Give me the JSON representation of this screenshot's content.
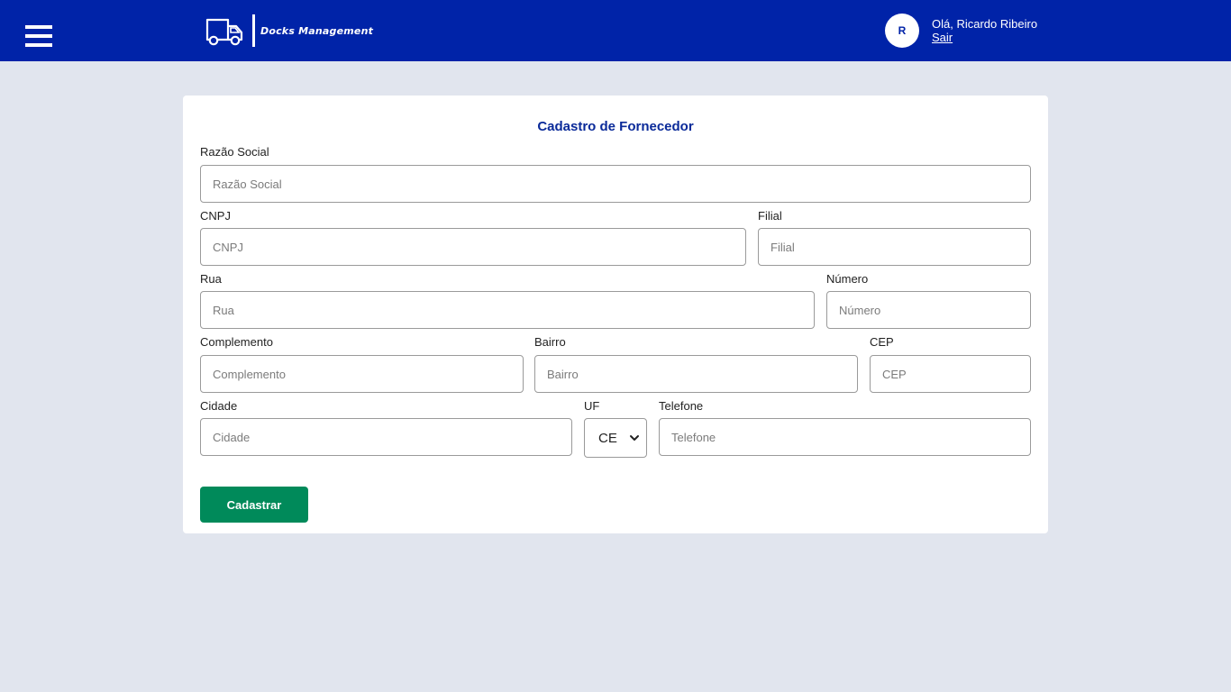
{
  "header": {
    "brand": "Docks Management",
    "avatar_initial": "R",
    "greeting": "Olá, Ricardo Ribeiro",
    "logout": "Sair",
    "bg_color": "#0023a8",
    "menu_icon": "hamburger-menu-icon",
    "logo_icon": "truck-icon"
  },
  "form": {
    "title": "Cadastro de Fornecedor",
    "fields": {
      "razao_social": {
        "label": "Razão Social",
        "placeholder": "Razão Social",
        "value": ""
      },
      "cnpj": {
        "label": "CNPJ",
        "placeholder": "CNPJ",
        "value": ""
      },
      "filial": {
        "label": "Filial",
        "placeholder": "Filial",
        "value": ""
      },
      "rua": {
        "label": "Rua",
        "placeholder": "Rua",
        "value": ""
      },
      "numero": {
        "label": "Número",
        "placeholder": "Número",
        "value": ""
      },
      "complemento": {
        "label": "Complemento",
        "placeholder": "Complemento",
        "value": ""
      },
      "bairro": {
        "label": "Bairro",
        "placeholder": "Bairro",
        "value": ""
      },
      "cep": {
        "label": "CEP",
        "placeholder": "CEP",
        "value": ""
      },
      "cidade": {
        "label": "Cidade",
        "placeholder": "Cidade",
        "value": ""
      },
      "uf": {
        "label": "UF",
        "selected": "CE"
      },
      "telefone": {
        "label": "Telefone",
        "placeholder": "Telefone",
        "value": ""
      }
    },
    "submit_label": "Cadastrar",
    "submit_color": "#008a5a"
  }
}
